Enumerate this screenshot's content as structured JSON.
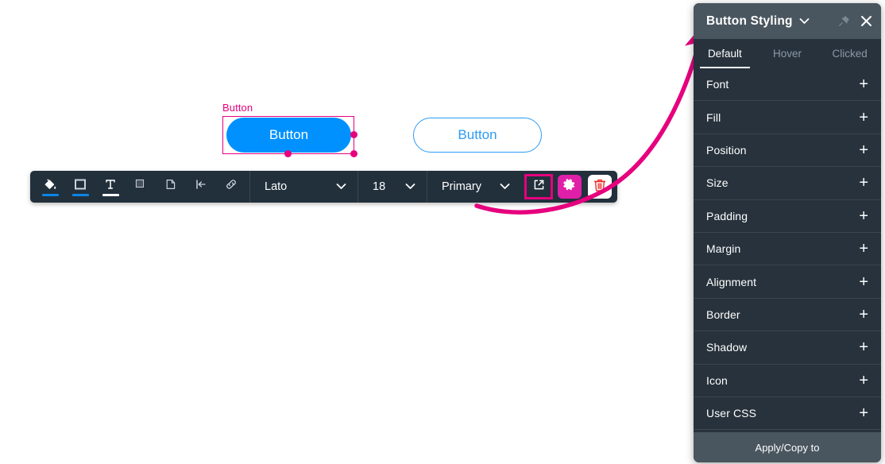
{
  "canvas": {
    "selected_button": {
      "selection_label": "Button",
      "text": "Button",
      "fill_color": "#0091FF",
      "selection_color": "#E6007E"
    },
    "outline_button": {
      "text": "Button",
      "border_color": "#2B9BF4",
      "text_color": "#2B9BF4"
    }
  },
  "toolbar": {
    "icons": [
      {
        "name": "fill-icon",
        "underline": "blue"
      },
      {
        "name": "border-icon",
        "underline": "blue"
      },
      {
        "name": "text-icon",
        "underline": "white"
      },
      {
        "name": "shadow-icon",
        "underline": "none"
      },
      {
        "name": "corner-radius-icon",
        "underline": "none"
      },
      {
        "name": "align-icon",
        "underline": "none"
      },
      {
        "name": "link-icon",
        "underline": "none"
      }
    ],
    "font_family": "Lato",
    "font_size": "18",
    "button_style": "Primary",
    "external_link_icon": "external-link-icon",
    "gear_icon": "gear-icon",
    "trash_icon": "trash-icon",
    "highlight_color": "#E6007E",
    "gear_color": "#E01FA8"
  },
  "panel": {
    "title": "Button Styling",
    "header_chevron_icon": "chevron-down-icon",
    "pin_icon": "pin-icon",
    "close_icon": "close-icon",
    "tabs": [
      {
        "label": "Default",
        "active": true
      },
      {
        "label": "Hover",
        "active": false
      },
      {
        "label": "Clicked",
        "active": false
      }
    ],
    "rows": [
      {
        "label": "Font"
      },
      {
        "label": "Fill"
      },
      {
        "label": "Position"
      },
      {
        "label": "Size"
      },
      {
        "label": "Padding"
      },
      {
        "label": "Margin"
      },
      {
        "label": "Alignment"
      },
      {
        "label": "Border"
      },
      {
        "label": "Shadow"
      },
      {
        "label": "Icon"
      },
      {
        "label": "User CSS"
      }
    ],
    "expand_symbol": "+",
    "footer_label": "Apply/Copy to",
    "background_color": "#27323C",
    "header_color": "#4A565F"
  }
}
